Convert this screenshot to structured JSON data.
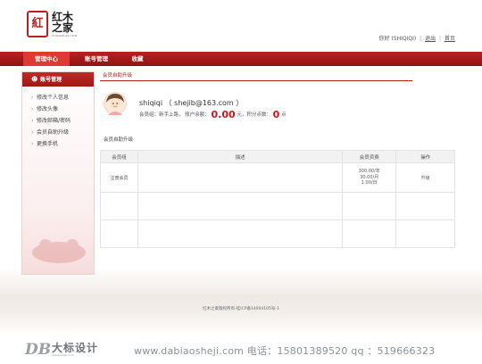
{
  "header": {
    "logo_seal": "紅",
    "logo_text_line1": "红木",
    "logo_text_line2": "之家",
    "logo_domain": "HONGMUZJ.COM",
    "greeting": "你好 (SHIQIQI)",
    "logout": "退出",
    "home": "首页"
  },
  "nav": {
    "items": [
      {
        "label": "管理中心"
      },
      {
        "label": "账号管理"
      },
      {
        "label": "收藏"
      }
    ]
  },
  "sidebar": {
    "title": "账号管理",
    "items": [
      {
        "label": "修改个人信息"
      },
      {
        "label": "修改头像"
      },
      {
        "label": "修改邮箱/密码"
      },
      {
        "label": "会员自助升级"
      },
      {
        "label": "更换手机"
      }
    ]
  },
  "main": {
    "breadcrumb": "会员自助升级",
    "username": "shiqiqi （ shejib@163.com ）",
    "level_prefix": "会员组：新手上路，  账户余额：",
    "balance": "0.00",
    "balance_unit": "元，积分点数：",
    "points": "0",
    "points_unit": "点",
    "section_title": "会员自助升级",
    "table": {
      "headers": [
        "会员组",
        "描述",
        "会员资费",
        "操作"
      ],
      "rows": [
        {
          "group": "注册会员",
          "desc": "",
          "fee_line1": "300.00/年",
          "fee_line2": "30.00/月",
          "fee_line3": "1.00/日",
          "action": "升级"
        }
      ]
    }
  },
  "footer": {
    "copyright": "红木之家版权所有-桂ICP备14004105号-1"
  },
  "watermark": {
    "logo": "DB",
    "name": "大标设计",
    "sub": "dabiaosheji.com",
    "info": "www.dabiaosheji.com  电话：15801389520  qq ：519666323"
  }
}
